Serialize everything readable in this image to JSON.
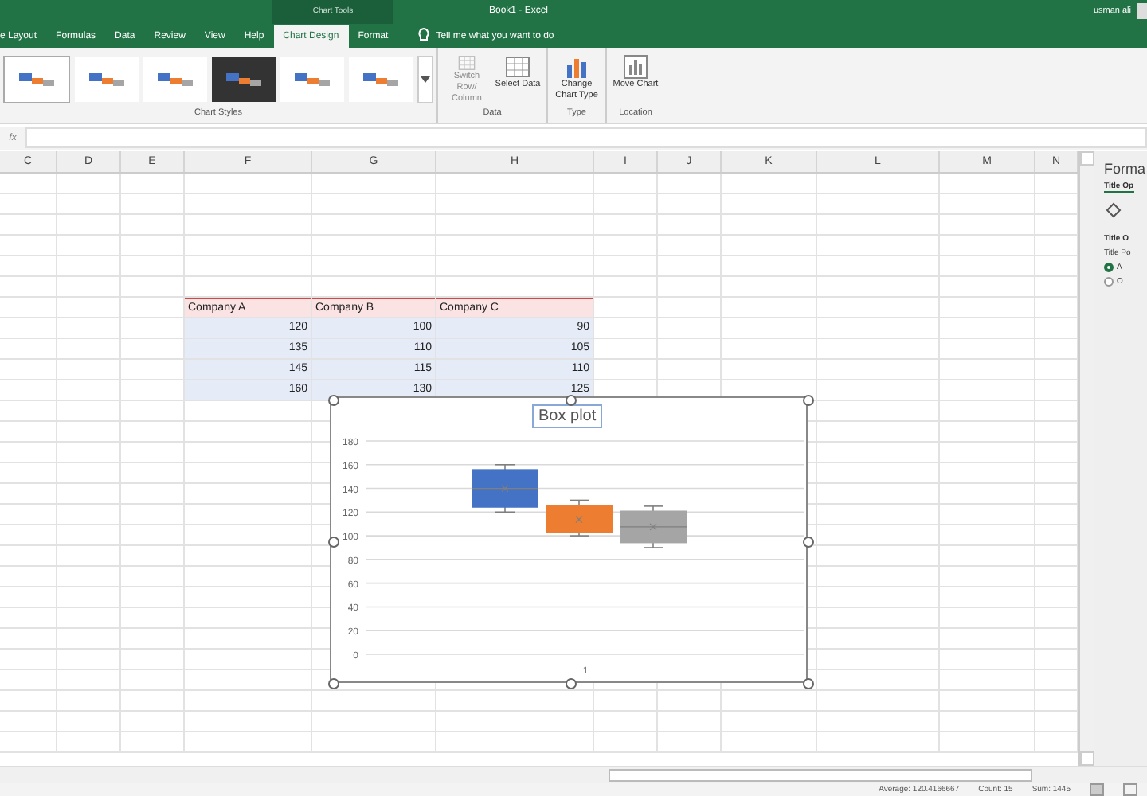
{
  "window": {
    "title": "Book1 - Excel",
    "context_label": "Chart Tools",
    "user": "usman ali"
  },
  "tabs": [
    {
      "label": "e Layout",
      "selected": false
    },
    {
      "label": "Formulas",
      "selected": false
    },
    {
      "label": "Data",
      "selected": false
    },
    {
      "label": "Review",
      "selected": false
    },
    {
      "label": "View",
      "selected": false
    },
    {
      "label": "Help",
      "selected": false
    },
    {
      "label": "Chart Design",
      "selected": true
    },
    {
      "label": "Format",
      "selected": false
    }
  ],
  "tell_me": {
    "placeholder": "Tell me what you want to do"
  },
  "ribbon": {
    "styles_label": "Chart Styles",
    "groups": [
      {
        "label": "Data",
        "buttons": [
          {
            "label": "Switch Row/ Column",
            "disabled": true,
            "kind": "switch"
          },
          {
            "label": "Select Data",
            "disabled": false,
            "kind": "select"
          }
        ]
      },
      {
        "label": "Type",
        "buttons": [
          {
            "label": "Change Chart Type",
            "disabled": false,
            "kind": "type"
          }
        ]
      },
      {
        "label": "Location",
        "buttons": [
          {
            "label": "Move Chart",
            "disabled": false,
            "kind": "move"
          }
        ]
      }
    ]
  },
  "formula_bar": {
    "fx": "fx"
  },
  "columns": [
    "C",
    "D",
    "E",
    "F",
    "G",
    "H",
    "I",
    "J",
    "K",
    "L",
    "M",
    "N"
  ],
  "table": {
    "columns": [
      "Company A",
      "Company B",
      "Company C"
    ],
    "rows": [
      [
        "120",
        "100",
        "90"
      ],
      [
        "135",
        "110",
        "105"
      ],
      [
        "145",
        "115",
        "110"
      ],
      [
        "160",
        "130",
        "125"
      ]
    ]
  },
  "chart": {
    "title": "Box plot",
    "x_label": "1",
    "y_labels": [
      "180",
      "160",
      "140",
      "120",
      "100",
      "80",
      "60",
      "40",
      "20",
      "0"
    ],
    "boxes": [
      {
        "color": "#4472c4"
      },
      {
        "color": "#ed7d31"
      },
      {
        "color": "#a5a5a5"
      }
    ]
  },
  "side_pane": {
    "title": "Forma",
    "section": "Title Op",
    "subsection": "Title O",
    "field_label": "Title Po",
    "options": [
      {
        "label": "A",
        "selected": true
      },
      {
        "label": "O",
        "selected": false
      }
    ]
  },
  "status_bar": {
    "average": "Average: 120.4166667",
    "count": "Count: 15",
    "sum": "Sum: 1445"
  }
}
